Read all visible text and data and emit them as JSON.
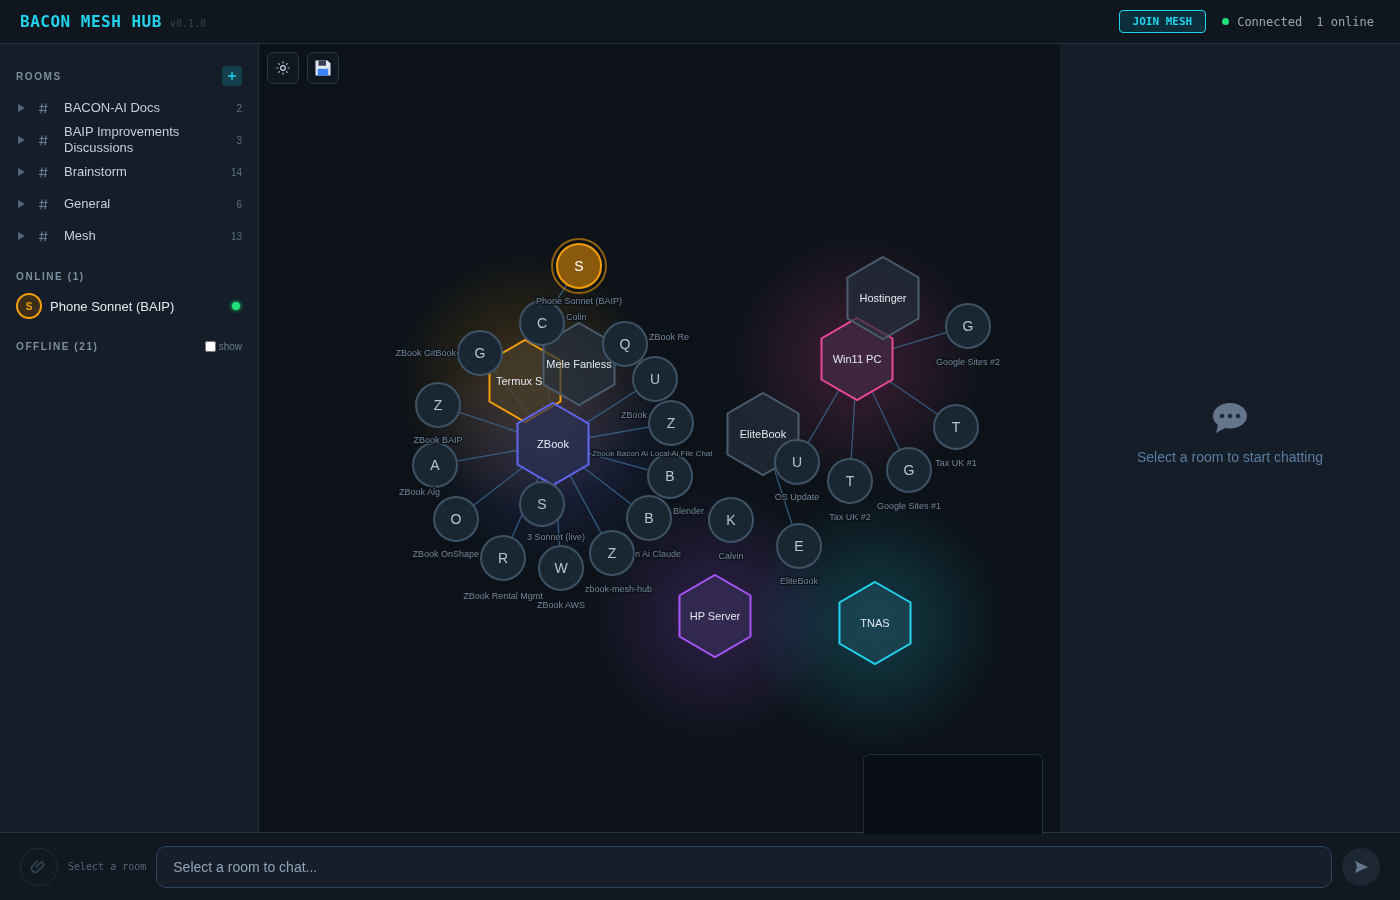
{
  "app": {
    "title": "BACON MESH HUB",
    "version": "v0.1.0"
  },
  "header": {
    "join_button": "JOIN MESH",
    "connection": {
      "label": "Connected",
      "connected": true
    },
    "online_count": "1 online"
  },
  "sidebar": {
    "rooms_heading": "ROOMS",
    "rooms": [
      {
        "name": "BACON-AI Docs",
        "count": "2",
        "expanded": false
      },
      {
        "name": "BAIP Improvements Discussions",
        "count": "3",
        "expanded": false
      },
      {
        "name": "Brainstorm",
        "count": "14",
        "expanded": false
      },
      {
        "name": "General",
        "count": "6",
        "expanded": false
      },
      {
        "name": "Mesh",
        "count": "13",
        "expanded": false
      }
    ],
    "online_heading": "ONLINE (1)",
    "online_users": [
      {
        "initial": "S",
        "name": "Phone Sonnet (BAIP)",
        "online": true
      }
    ],
    "offline_heading": "OFFLINE (21)",
    "show_offline": {
      "label": "show",
      "checked": false
    }
  },
  "graph": {
    "hubs": [
      {
        "label": "Termux S",
        "color": "#f59e0b"
      },
      {
        "label": "Mele Fanless",
        "color": "#4b5d6e"
      },
      {
        "label": "Win11 PC",
        "color": "#ec4899"
      },
      {
        "label": "Hostinger",
        "color": "#4b5d6e"
      },
      {
        "label": "ZBook",
        "color": "#6366f1"
      },
      {
        "label": "EliteBook",
        "color": "#4b5d6e"
      },
      {
        "label": "HP Server",
        "color": "#a855f7"
      },
      {
        "label": "TNAS",
        "color": "#22d3ee"
      }
    ],
    "nodes": [
      {
        "letter": "S",
        "caption": "Phone Sonnet (BAIP)",
        "online": true
      },
      {
        "letter": "C",
        "caption": "Colin",
        "online": false
      },
      {
        "letter": "G",
        "caption": "Google Sites #2",
        "online": false
      },
      {
        "letter": "G",
        "caption": "ZBook GitBook",
        "online": false
      },
      {
        "letter": "Q",
        "caption": "ZBook Re",
        "online": false
      },
      {
        "letter": "U",
        "caption": "ZBook",
        "online": false
      },
      {
        "letter": "Z",
        "caption": "ZBook BAIP",
        "online": false
      },
      {
        "letter": "Z",
        "caption": "Zbook Bacon Ai Local Ai File Chat",
        "online": false
      },
      {
        "letter": "T",
        "caption": "Tax UK #1",
        "online": false
      },
      {
        "letter": "A",
        "caption": "ZBook Alg",
        "online": false
      },
      {
        "letter": "B",
        "caption": "Blender",
        "online": false
      },
      {
        "letter": "U",
        "caption": "OS Update",
        "online": false
      },
      {
        "letter": "T",
        "caption": "Tax UK #2",
        "online": false
      },
      {
        "letter": "G",
        "caption": "Google Sites #1",
        "online": false
      },
      {
        "letter": "S",
        "caption": "3 Sonnet (live)",
        "online": false
      },
      {
        "letter": "O",
        "caption": "ZBook OnShape",
        "online": false
      },
      {
        "letter": "B",
        "caption": "n Ai Claude",
        "online": false
      },
      {
        "letter": "K",
        "caption": "Calvin",
        "online": false
      },
      {
        "letter": "R",
        "caption": "ZBook Rental Mgmt",
        "online": false
      },
      {
        "letter": "W",
        "caption": "ZBook AWS",
        "online": false
      },
      {
        "letter": "Z",
        "caption": "zbook-mesh-hub",
        "online": false
      },
      {
        "letter": "E",
        "caption": "EliteBook",
        "online": false
      }
    ]
  },
  "chat": {
    "empty_message": "Select a room to start chatting"
  },
  "composer": {
    "room_hint": "Select a room",
    "placeholder": "Select a room to chat..."
  }
}
